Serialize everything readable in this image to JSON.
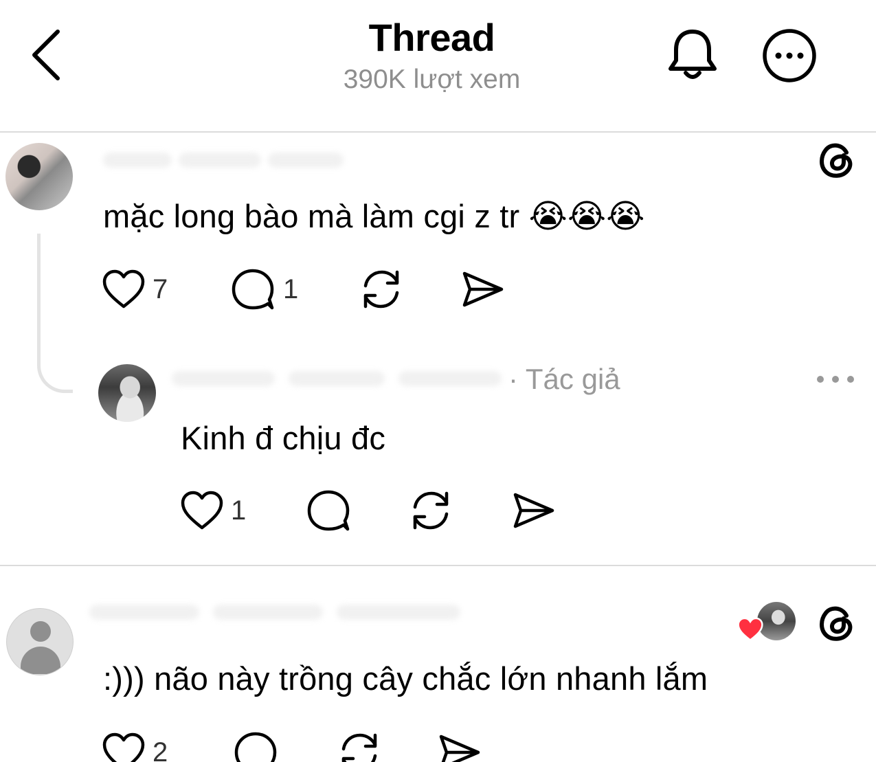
{
  "header": {
    "title": "Thread",
    "views": "390K lượt xem"
  },
  "posts": [
    {
      "text": "mặc long bào mà làm cgi z tr",
      "emojis": "😭😭😭",
      "likes": "7",
      "replies": "1"
    },
    {
      "author_tag": "· Tác giả",
      "text": "Kinh đ chịu đc",
      "likes": "1"
    },
    {
      "text": ":))) não này trồng cây chắc lớn nhanh lắm",
      "likes": "2"
    }
  ],
  "icons": {
    "back": "chevron-left-icon",
    "bell": "bell-icon",
    "more": "more-circle-icon",
    "threads": "threads-logo-icon",
    "like": "heart-icon",
    "comment": "comment-bubble-icon",
    "repost": "repost-icon",
    "share": "send-icon"
  },
  "colors": {
    "liked_heart": "#ff3040",
    "muted_text": "#8e8e8e"
  }
}
